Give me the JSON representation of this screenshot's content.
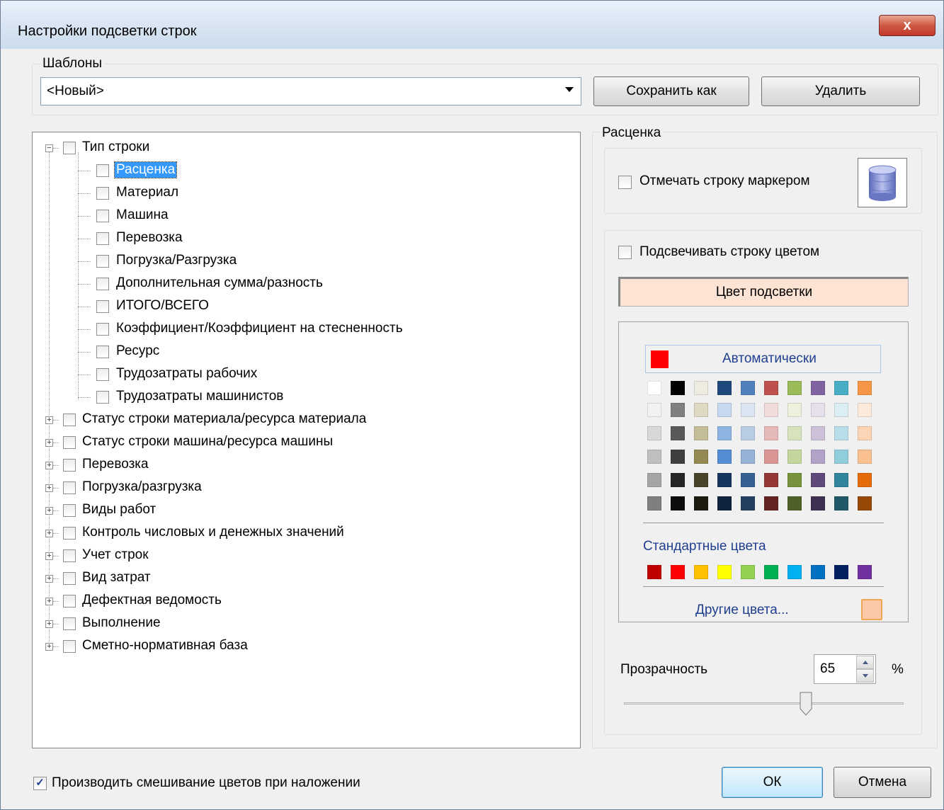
{
  "window": {
    "title": "Настройки подсветки строк",
    "close_label": "x"
  },
  "templates": {
    "group_label": "Шаблоны",
    "selected": "<Новый>",
    "save_as_label": "Сохранить как",
    "delete_label": "Удалить"
  },
  "tree": {
    "root": {
      "label": "Тип строки",
      "expanded": true
    },
    "children": [
      "Расценка",
      "Материал",
      "Машина",
      "Перевозка",
      "Погрузка/Разгрузка",
      "Дополнительная сумма/разность",
      "ИТОГО/ВСЕГО",
      "Коэффициент/Коэффициент на стесненность",
      "Ресурс",
      "Трудозатраты рабочих",
      "Трудозатраты машинистов"
    ],
    "selected_child": "Расценка",
    "collapsed": [
      "Статус строки материала/ресурса материала",
      "Статус строки машина/ресурса машины",
      "Перевозка",
      "Погрузка/разгрузка",
      "Виды работ",
      "Контроль числовых и денежных значений",
      "Учет строк",
      "Вид затрат",
      "Дефектная ведомость",
      "Выполнение",
      "Сметно-нормативная база"
    ]
  },
  "right_panel": {
    "group_label": "Расценка",
    "mark_row_label": "Отмечать строку маркером",
    "highlight_row_label": "Подсвечивать строку цветом",
    "highlight_color_label": "Цвет подсветки",
    "highlight_color": "#fde3d3",
    "auto_label": "Автоматически",
    "auto_color": "#ff0000",
    "palette_rows": [
      [
        "#ffffff",
        "#000000",
        "#eeece1",
        "#1f497d",
        "#4f81bd",
        "#c0504d",
        "#9bbb59",
        "#8064a2",
        "#4bacc6",
        "#f79646"
      ],
      [
        "#f2f2f2",
        "#7f7f7f",
        "#ddd9c3",
        "#c6d9f0",
        "#dbe5f1",
        "#f2dcdb",
        "#ebf1dd",
        "#e5e0ec",
        "#dbeef3",
        "#fdeada"
      ],
      [
        "#d8d8d8",
        "#595959",
        "#c4bd97",
        "#8db3e2",
        "#b8cce4",
        "#e5b9b7",
        "#d7e3bc",
        "#ccc1d9",
        "#b7dde8",
        "#fbd5b5"
      ],
      [
        "#bfbfbf",
        "#3f3f3f",
        "#938953",
        "#548dd4",
        "#95b3d7",
        "#d99694",
        "#c3d69b",
        "#b2a2c7",
        "#92cddc",
        "#fac08f"
      ],
      [
        "#a5a5a5",
        "#262626",
        "#494429",
        "#17365d",
        "#366092",
        "#953734",
        "#76923c",
        "#5f497a",
        "#31859b",
        "#e36c09"
      ],
      [
        "#7f7f7f",
        "#0c0c0c",
        "#1d1b10",
        "#0f243e",
        "#244061",
        "#632423",
        "#4f6128",
        "#3f3151",
        "#205867",
        "#974806"
      ]
    ],
    "standard_label": "Стандартные цвета",
    "standard_colors": [
      "#c00000",
      "#ff0000",
      "#ffc000",
      "#ffff00",
      "#92d050",
      "#00b050",
      "#00b0f0",
      "#0070c0",
      "#002060",
      "#7030a0"
    ],
    "more_colors_label": "Другие цвета...",
    "more_color_swatch": "#fcc9a8",
    "transparency_label": "Прозрачность",
    "transparency_value": "65",
    "transparency_unit": "%",
    "transparency_fraction": 0.65
  },
  "footer": {
    "blend_label": "Производить смешивание цветов при наложении",
    "blend_checked": true,
    "ok_label": "ОК",
    "cancel_label": "Отмена"
  }
}
